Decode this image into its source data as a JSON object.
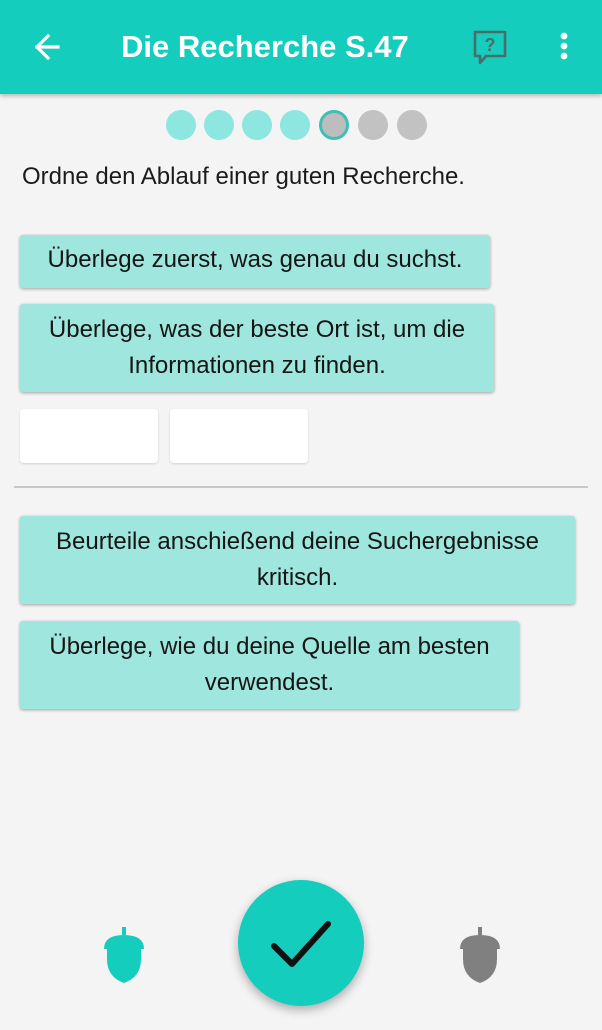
{
  "header": {
    "title": "Die Recherche S.47",
    "back_icon": "arrow-left-icon",
    "help_icon": "help-bubble-icon",
    "menu_icon": "more-vertical-icon",
    "color": "#14cdbd"
  },
  "progress": {
    "total": 7,
    "current": 5,
    "states": [
      "done",
      "done",
      "done",
      "done",
      "current",
      "todo",
      "todo"
    ]
  },
  "task": {
    "instruction": "Ordne den Ablauf einer guten Recherche."
  },
  "answer_area": {
    "cards": [
      {
        "line1": "Überlege zuerst, was genau du suchst.",
        "line2": ""
      },
      {
        "line1": "Überlege, was der beste Ort ist, um die",
        "line2": "Informationen zu finden."
      }
    ],
    "empty_slots": 2
  },
  "pool": {
    "cards": [
      {
        "line1": "Beurteile anschießend deine Suchergebnisse",
        "line2": "kritisch."
      },
      {
        "line1": "Überlege, wie du deine Quelle am besten",
        "line2": "verwendest."
      }
    ]
  },
  "footer": {
    "left_icon": "acorn-icon",
    "left_color": "#14cdbd",
    "check_icon": "checkmark-icon",
    "right_icon": "acorn-icon",
    "right_color": "#808080"
  }
}
